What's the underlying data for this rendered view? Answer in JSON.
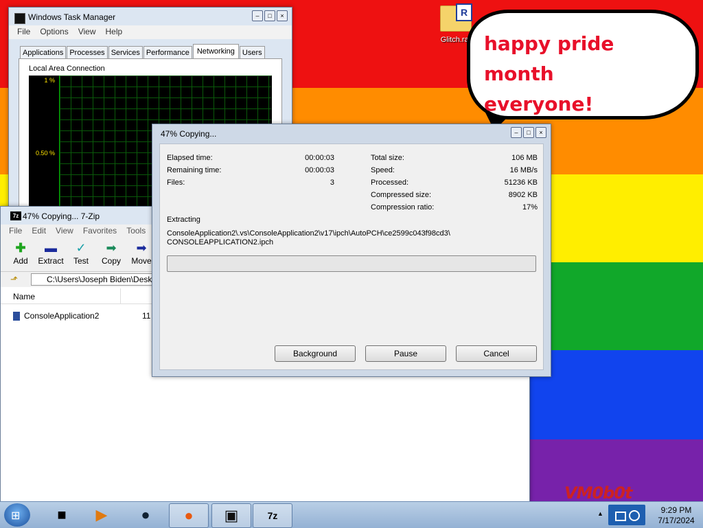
{
  "desktop": {
    "bubble_line1": "happy pride month",
    "bubble_line2": "everyone!",
    "icon_label": "Glitch.rar",
    "watermark": "VM0b0t"
  },
  "taskmgr": {
    "title": "Windows Task Manager",
    "menu": [
      "File",
      "Options",
      "View",
      "Help"
    ],
    "tabs": [
      "Applications",
      "Processes",
      "Services",
      "Performance",
      "Networking",
      "Users"
    ],
    "active_tab": "Networking",
    "section": "Local Area Connection",
    "graph_labels": [
      "1 %",
      "0.50 %"
    ]
  },
  "zip": {
    "title": "47% Copying... 7-Zip",
    "menu": [
      "File",
      "Edit",
      "View",
      "Favorites",
      "Tools"
    ],
    "toolbar": [
      "Add",
      "Extract",
      "Test",
      "Copy",
      "Move"
    ],
    "address": "C:\\Users\\Joseph Biden\\Deskt",
    "column_name": "Name",
    "row_name": "ConsoleApplication2",
    "row_size": "11"
  },
  "copy_dialog": {
    "title": "47% Copying...",
    "elapsed_label": "Elapsed time:",
    "elapsed_value": "00:00:03",
    "remaining_label": "Remaining time:",
    "remaining_value": "00:00:03",
    "files_label": "Files:",
    "files_value": "3",
    "total_label": "Total size:",
    "total_value": "106 MB",
    "speed_label": "Speed:",
    "speed_value": "16 MB/s",
    "processed_label": "Processed:",
    "processed_value": "51236 KB",
    "compressed_label": "Compressed size:",
    "compressed_value": "8902 KB",
    "ratio_label": "Compression ratio:",
    "ratio_value": "17%",
    "status": "Extracting",
    "path_line1": "ConsoleApplication2\\.vs\\ConsoleApplication2\\v17\\ipch\\AutoPCH\\ce2599c043f98cd3\\",
    "path_line2": "CONSOLEAPPLICATION2.ipch",
    "progress_percent": 0,
    "btn_background": "Background",
    "btn_pause": "Pause",
    "btn_cancel": "Cancel"
  },
  "taskbar": {
    "time": "9:29 PM",
    "date": "7/17/2024"
  }
}
